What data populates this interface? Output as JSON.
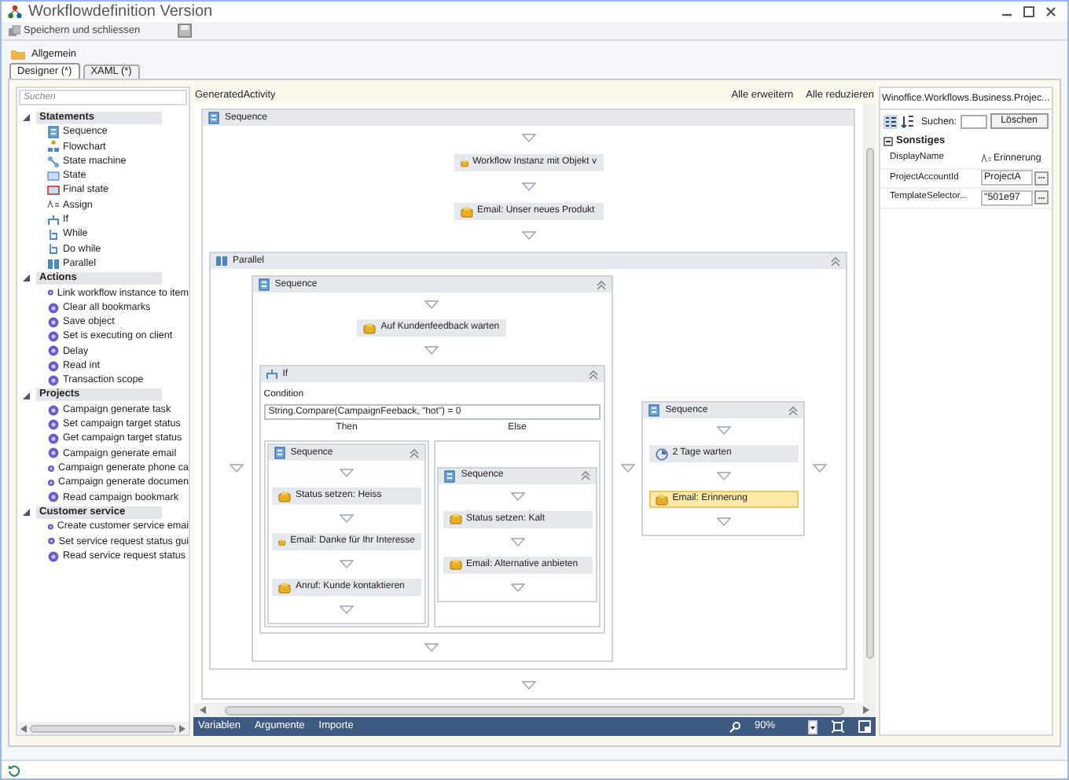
{
  "window": {
    "title": "Workflowdefinition Version"
  },
  "toolbar": {
    "save_label": "Speichern und schliessen"
  },
  "section": {
    "label": "Allgemein"
  },
  "tabs": [
    {
      "label": "Designer (*)",
      "selected": true
    },
    {
      "label": "XAML (*)",
      "selected": false
    }
  ],
  "toolbox": {
    "search": {
      "placeholder": "Suchen"
    },
    "categories": [
      {
        "label": "Statements",
        "expanded": true,
        "items": [
          {
            "label": "Sequence",
            "kind": "sequence"
          },
          {
            "label": "Flowchart",
            "kind": "flowchart"
          },
          {
            "label": "State machine",
            "kind": "statemachine"
          },
          {
            "label": "State",
            "kind": "state"
          },
          {
            "label": "Final state",
            "kind": "finalstate"
          },
          {
            "label": "Assign",
            "kind": "assign"
          },
          {
            "label": "If",
            "kind": "if"
          },
          {
            "label": "While",
            "kind": "loop"
          },
          {
            "label": "Do while",
            "kind": "loop"
          },
          {
            "label": "Parallel",
            "kind": "parallel"
          }
        ]
      },
      {
        "label": "Actions",
        "expanded": true,
        "items": [
          {
            "label": "Link workflow instance to item",
            "kind": "custom"
          },
          {
            "label": "Clear all bookmarks",
            "kind": "custom"
          },
          {
            "label": "Save object",
            "kind": "custom"
          },
          {
            "label": "Set is executing on client",
            "kind": "custom"
          },
          {
            "label": "Delay",
            "kind": "custom"
          },
          {
            "label": "Read int",
            "kind": "custom"
          },
          {
            "label": "Transaction scope",
            "kind": "custom"
          }
        ]
      },
      {
        "label": "Projects",
        "expanded": true,
        "items": [
          {
            "label": "Campaign generate task",
            "kind": "custom"
          },
          {
            "label": "Set campaign target status",
            "kind": "custom"
          },
          {
            "label": "Get campaign target status",
            "kind": "custom"
          },
          {
            "label": "Campaign generate email",
            "kind": "custom"
          },
          {
            "label": "Campaign generate phone ca",
            "kind": "custom"
          },
          {
            "label": "Campaign generate documen",
            "kind": "custom"
          },
          {
            "label": "Read campaign bookmark",
            "kind": "custom"
          }
        ]
      },
      {
        "label": "Customer service",
        "expanded": true,
        "items": [
          {
            "label": "Create customer service emai",
            "kind": "custom"
          },
          {
            "label": "Set service request status gui",
            "kind": "custom"
          },
          {
            "label": "Read service request status",
            "kind": "custom"
          }
        ]
      }
    ]
  },
  "designer": {
    "breadcrumb": "GeneratedActivity",
    "expand_all": "Alle erweitern",
    "collapse_all": "Alle reduzieren",
    "root": {
      "kind": "sequence",
      "title": "Sequence",
      "collapsible": false,
      "children": [
        {
          "kind": "activity",
          "label": "Workflow Instanz mit Objekt v",
          "selected": false
        },
        {
          "kind": "activity",
          "label": "Email: Unser neues Produkt",
          "selected": false
        },
        {
          "kind": "parallel",
          "title": "Parallel",
          "collapsible": true,
          "children": [
            {
              "kind": "sequence",
              "title": "Sequence",
              "collapsible": true,
              "children": [
                {
                  "kind": "activity",
                  "label": "Auf Kundenfeedback warten",
                  "selected": false
                },
                {
                  "kind": "if",
                  "title": "If",
                  "collapsible": true,
                  "condition_label": "Condition",
                  "condition": "String.Compare(CampaignFeeback, \"hot\") = 0",
                  "then_label": "Then",
                  "else_label": "Else",
                  "then": {
                    "kind": "sequence",
                    "title": "Sequence",
                    "collapsible": true,
                    "children": [
                      {
                        "kind": "activity",
                        "label": "Status setzen: Heiss",
                        "selected": false
                      },
                      {
                        "kind": "activity",
                        "label": "Email: Danke für Ihr Interesse",
                        "selected": false
                      },
                      {
                        "kind": "activity",
                        "label": "Anruf: Kunde kontaktieren",
                        "selected": false
                      }
                    ]
                  },
                  "else": {
                    "kind": "sequence",
                    "title": "Sequence",
                    "collapsible": true,
                    "children": [
                      {
                        "kind": "activity",
                        "label": "Status setzen: Kalt",
                        "selected": false
                      },
                      {
                        "kind": "activity",
                        "label": "Email: Alternative anbieten",
                        "selected": false
                      }
                    ]
                  }
                }
              ]
            },
            {
              "kind": "sequence",
              "title": "Sequence",
              "collapsible": true,
              "children": [
                {
                  "kind": "delay",
                  "label": "2 Tage warten",
                  "selected": false
                },
                {
                  "kind": "activity",
                  "label": "Email: Erinnerung",
                  "selected": true
                }
              ]
            }
          ]
        }
      ]
    },
    "bottom_tabs": [
      "Variablen",
      "Argumente",
      "Importe"
    ],
    "zoom": "90%"
  },
  "properties": {
    "title": "Winoffice.Workflows.Business.Projec...",
    "search_label": "Suchen:",
    "clear_button": "Löschen",
    "category": "Sonstiges",
    "rows": [
      {
        "name": "DisplayName",
        "value": "Erinnerung",
        "kind": "text"
      },
      {
        "name": "ProjectAccountId",
        "value": "ProjectA",
        "kind": "editor"
      },
      {
        "name": "TemplateSelector...",
        "value": "\"501e97",
        "kind": "editor"
      }
    ]
  }
}
